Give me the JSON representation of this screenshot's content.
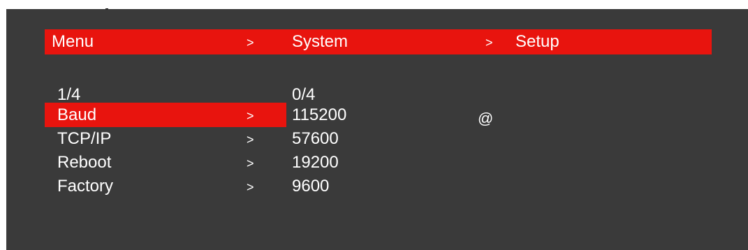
{
  "breadcrumb": {
    "items": [
      "Menu",
      "System",
      "Setup"
    ],
    "separator": ">"
  },
  "left_panel": {
    "page_indicator": "1/4",
    "items": [
      {
        "label": "Baud",
        "arrow": ">"
      },
      {
        "label": "TCP/IP",
        "arrow": ">"
      },
      {
        "label": "Reboot",
        "arrow": ">"
      },
      {
        "label": "Factory",
        "arrow": ">"
      }
    ],
    "selected_index": 0
  },
  "right_panel": {
    "page_indicator": "0/4",
    "options": [
      "115200",
      "57600",
      "19200",
      "9600"
    ],
    "current_marker": "@",
    "current_index": 0
  },
  "colors": {
    "background": "#3a3a3a",
    "highlight": "#e8140e",
    "text": "#ffffff"
  }
}
